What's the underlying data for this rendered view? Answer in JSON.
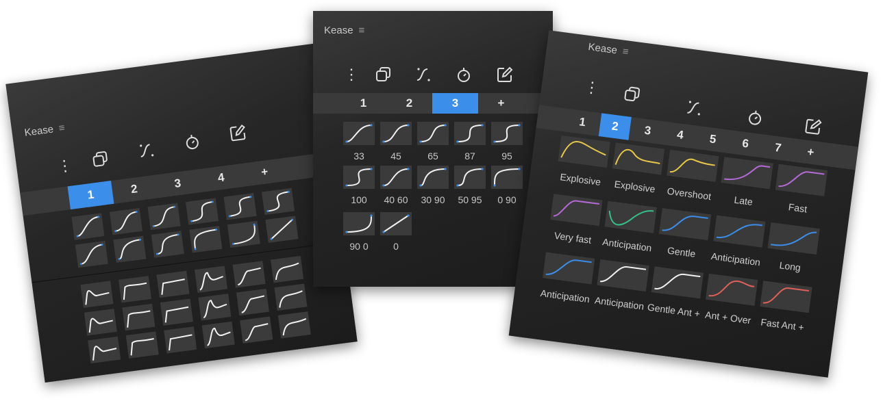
{
  "colors": {
    "accent": "#3b8eea",
    "curve_white": "#f2f2f2",
    "handle_blue": "#3b8eea",
    "yellow": "#e8c84a",
    "purple": "#b66ad8",
    "green": "#36c08a",
    "blue": "#3b8eea",
    "red": "#e0605a"
  },
  "icons": [
    "more-vertical-icon",
    "copy-icon",
    "curve-icon",
    "stopwatch-icon",
    "edit-icon",
    "plus-icon",
    "menu-icon"
  ],
  "left_panel": {
    "title": "Kease",
    "menu": "≡",
    "more": "⋮",
    "tabs": [
      "1",
      "2",
      "3",
      "4",
      "+"
    ],
    "active_tab": "1"
  },
  "center_panel": {
    "title": "Kease",
    "menu": "≡",
    "more": "⋮",
    "tabs": [
      "1",
      "2",
      "3",
      "+"
    ],
    "active_tab": "3",
    "curves": [
      "33",
      "45",
      "65",
      "87",
      "95",
      "100",
      "40 60",
      "30 90",
      "50 95",
      "0 90",
      "90 0",
      "0"
    ]
  },
  "right_panel": {
    "title": "Kease",
    "menu": "≡",
    "more": "⋮",
    "tabs": [
      "1",
      "2",
      "3",
      "4",
      "5",
      "6",
      "7",
      "+"
    ],
    "active_tab": "2",
    "presets": [
      {
        "label": "Explosive",
        "color": "yellow"
      },
      {
        "label": "Explosive",
        "color": "yellow"
      },
      {
        "label": "Overshoot",
        "color": "yellow"
      },
      {
        "label": "Late",
        "color": "purple"
      },
      {
        "label": "Fast",
        "color": "purple"
      },
      {
        "label": "Very fast",
        "color": "purple"
      },
      {
        "label": "Anticipation",
        "color": "green"
      },
      {
        "label": "Gentle",
        "color": "blue"
      },
      {
        "label": "Anticipation",
        "color": "blue"
      },
      {
        "label": "Long",
        "color": "blue"
      },
      {
        "label": "Anticipation",
        "color": "blue"
      },
      {
        "label": "Anticipation",
        "color": "white"
      },
      {
        "label": "Gentle Ant +",
        "color": "white"
      },
      {
        "label": "Ant + Over",
        "color": "red"
      },
      {
        "label": "Fast Ant +",
        "color": "red"
      }
    ]
  }
}
